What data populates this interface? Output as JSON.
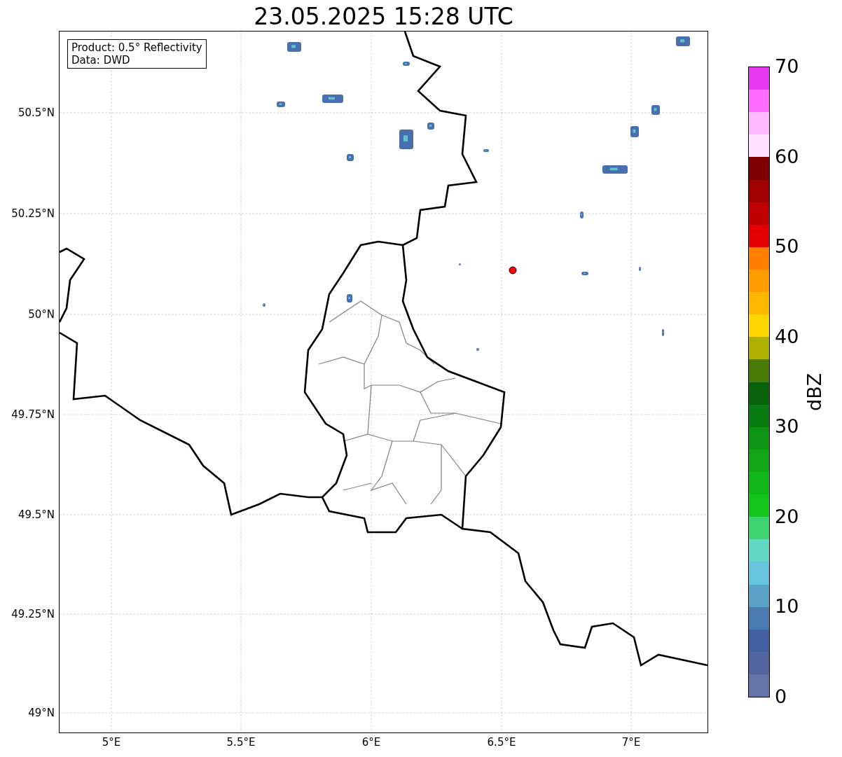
{
  "title": "23.05.2025 15:28 UTC",
  "legend": [
    "Product: 0.5° Reflectivity",
    "Data: DWD"
  ],
  "y_ticks": [
    "50.5°N",
    "50.25°N",
    "50°N",
    "49.75°N",
    "49.5°N",
    "49.25°N",
    "49°N"
  ],
  "x_ticks": [
    "5°E",
    "5.5°E",
    "6°E",
    "6.5°E",
    "7°E"
  ],
  "colorbar": {
    "label": "dBZ",
    "ticks": [
      "70",
      "60",
      "50",
      "40",
      "30",
      "20",
      "10",
      "0"
    ],
    "bands": [
      {
        "color": "#e838f0"
      },
      {
        "color": "#ff6cff"
      },
      {
        "color": "#ffb8ff"
      },
      {
        "color": "#ffe0ff"
      },
      {
        "color": "#7e0000"
      },
      {
        "color": "#a00000"
      },
      {
        "color": "#c00000"
      },
      {
        "color": "#e40000"
      },
      {
        "color": "#ff7f00"
      },
      {
        "color": "#ff9c00"
      },
      {
        "color": "#ffb800"
      },
      {
        "color": "#ffd700"
      },
      {
        "color": "#b0b000"
      },
      {
        "color": "#487a08"
      },
      {
        "color": "#08620c"
      },
      {
        "color": "#0a7b10"
      },
      {
        "color": "#0e9415"
      },
      {
        "color": "#10a615"
      },
      {
        "color": "#10b81a"
      },
      {
        "color": "#12c61a"
      },
      {
        "color": "#3fd56e"
      },
      {
        "color": "#62d8c4"
      },
      {
        "color": "#68c3dd"
      },
      {
        "color": "#5ba0c6"
      },
      {
        "color": "#4a7ab2"
      },
      {
        "color": "#4260a2"
      },
      {
        "color": "#5265a0"
      },
      {
        "color": "#6374a6"
      }
    ]
  }
}
